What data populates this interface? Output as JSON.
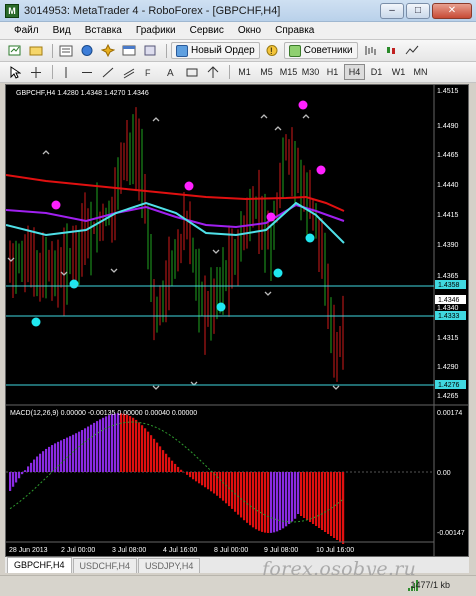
{
  "window": {
    "title": "3014953: MetaTrader 4 - RoboForex - [GBPCHF,H4]",
    "app_icon": "mt4-icon",
    "minimize": "–",
    "maximize": "□",
    "close": "✕"
  },
  "menu": [
    "Файл",
    "Вид",
    "Вставка",
    "Графики",
    "Сервис",
    "Окно",
    "Справка"
  ],
  "toolbar": {
    "new_order": "Новый Ордер",
    "advisors": "Советники"
  },
  "timeframes": [
    "M1",
    "M5",
    "M15",
    "M30",
    "H1",
    "H4",
    "D1",
    "W1",
    "MN"
  ],
  "active_timeframe": "H4",
  "chart": {
    "header": "GBPCHF,H4  1.4280 1.4348 1.4270 1.4346",
    "price_labels": [
      "1.4515",
      "1.4490",
      "1.4465",
      "1.4440",
      "1.4415",
      "1.4390",
      "1.4365",
      "1.4340",
      "1.4315",
      "1.4290",
      "1.4265"
    ],
    "marker_labels": [
      "1.4358",
      "1.4346",
      "1.4340",
      "1.4333",
      "1.4276"
    ],
    "macd_header": "MACD(12,26,9) 0.00000 -0.00135 0.00000 0.00040 0.00000",
    "macd_labels": [
      "0.00174",
      "0.00",
      "-0.00147"
    ],
    "date_labels": [
      "28 Jun 2013",
      "2 Jul 00:00",
      "3 Jul 08:00",
      "4 Jul 16:00",
      "8 Jul 00:00",
      "9 Jul 08:00",
      "10 Jul 16:00"
    ]
  },
  "tabs": [
    "GBPCHF,H4",
    "USDCHF,H4",
    "USDJPY,H4"
  ],
  "active_tab": "GBPCHF,H4",
  "status": {
    "size": "1477/1 kb"
  },
  "watermark": "forex.osobye.ru",
  "colors": {
    "chart_bg": "#000000",
    "bull": "#1fa31f",
    "bear": "#d11a1a",
    "ma_red": "#e01010",
    "ma_purple": "#a020f0",
    "ma_cyan": "#4fe0e8",
    "dots_magenta": "#ff20ff",
    "dots_cyan": "#20e8f0",
    "macd_blue": "#8a2be2",
    "macd_red": "#e01010"
  }
}
